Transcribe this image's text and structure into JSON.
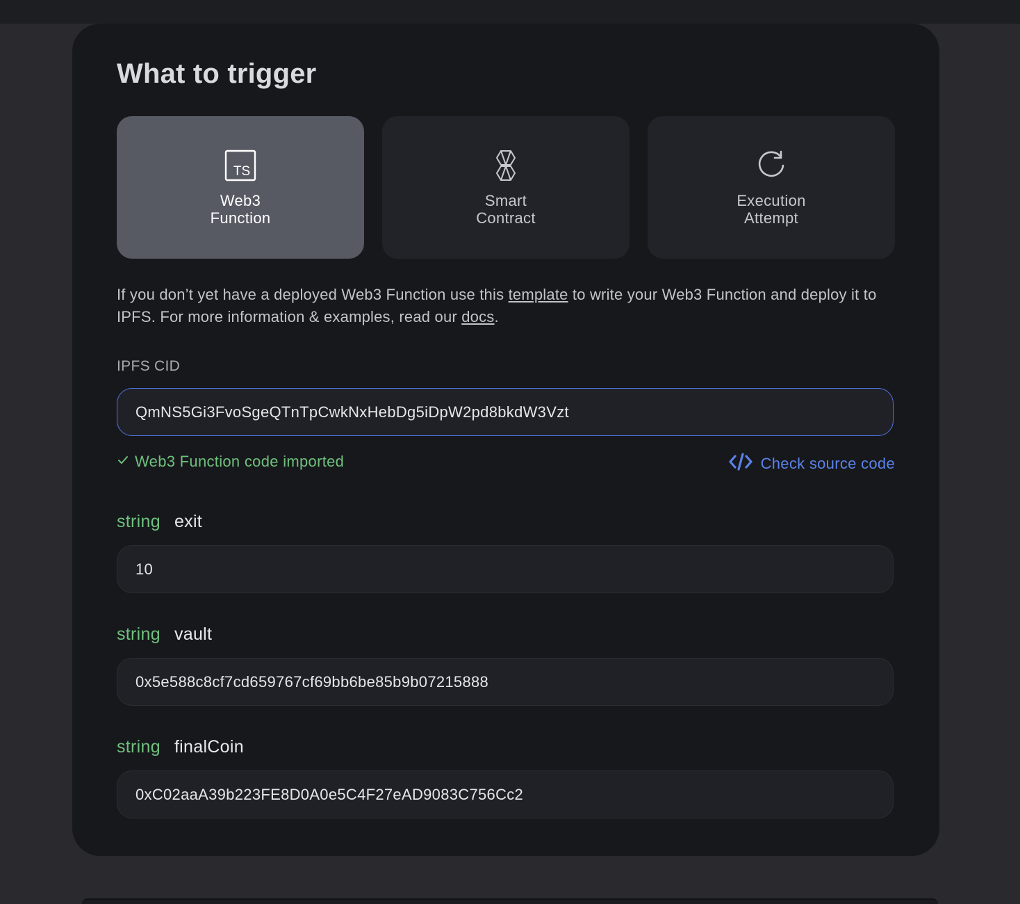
{
  "section": {
    "title": "What to trigger"
  },
  "options": [
    {
      "label_line1": "Web3",
      "label_line2": "Function",
      "icon": "typescript-icon",
      "selected": true
    },
    {
      "label_line1": "Smart",
      "label_line2": "Contract",
      "icon": "ethereum-icon",
      "selected": false
    },
    {
      "label_line1": "Execution",
      "label_line2": "Attempt",
      "icon": "refresh-icon",
      "selected": false
    }
  ],
  "description": {
    "part1": "If you don’t yet have a deployed Web3 Function use this ",
    "link_template": "template",
    "part2": " to write your Web3 Function and deploy it to IPFS. For more information & examples, read our ",
    "link_docs": "docs",
    "part3": "."
  },
  "ipfs": {
    "label": "IPFS CID",
    "value": "QmNS5Gi3FvoSgeQTnTpCwkNxHebDg5iDpW2pd8bkdW3Vzt"
  },
  "status": {
    "text": "Web3 Function code imported",
    "icon": "checkmark-icon",
    "color": "#6fc17d"
  },
  "check_source": {
    "label": "Check source code",
    "icon": "code-icon",
    "color": "#5b82e8"
  },
  "params": [
    {
      "type": "string",
      "name": "exit",
      "value": "10"
    },
    {
      "type": "string",
      "name": "vault",
      "value": "0x5e588c8cf7cd659767cf69bb6be85b9b07215888"
    },
    {
      "type": "string",
      "name": "finalCoin",
      "value": "0xC02aaA39b223FE8D0A0e5C4F27eAD9083C756Cc2"
    }
  ]
}
